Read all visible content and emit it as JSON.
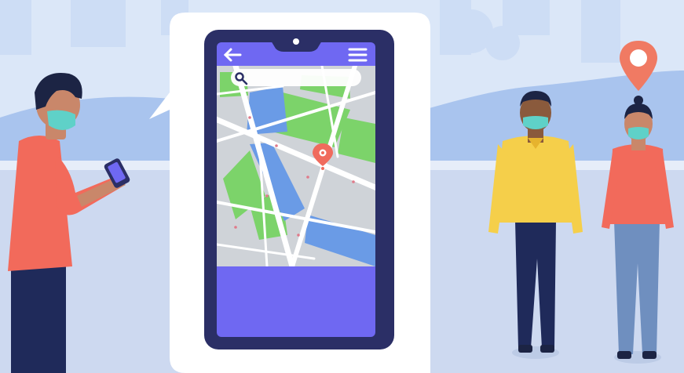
{
  "illustration": {
    "subject": "people-wearing-masks-using-map-app",
    "colors": {
      "sky": "#dbe7f8",
      "hills": "#a9c4ee",
      "ground": "#cdd9f0",
      "bubble": "#ffffff",
      "phone_frame": "#2b2f66",
      "screen_header": "#6f68f2",
      "map_road": "#ffffff",
      "map_block": "#cfd3d8",
      "map_park": "#7cd36a",
      "map_water": "#6a9be6",
      "map_pin": "#f06b5d",
      "location_pin": "#f07a63",
      "mask": "#5fd1c8"
    },
    "phone_app": {
      "back_icon": "arrow-left-icon",
      "menu_icon": "hamburger-menu-icon",
      "search_icon": "magnifier-icon",
      "search_placeholder": ""
    }
  }
}
